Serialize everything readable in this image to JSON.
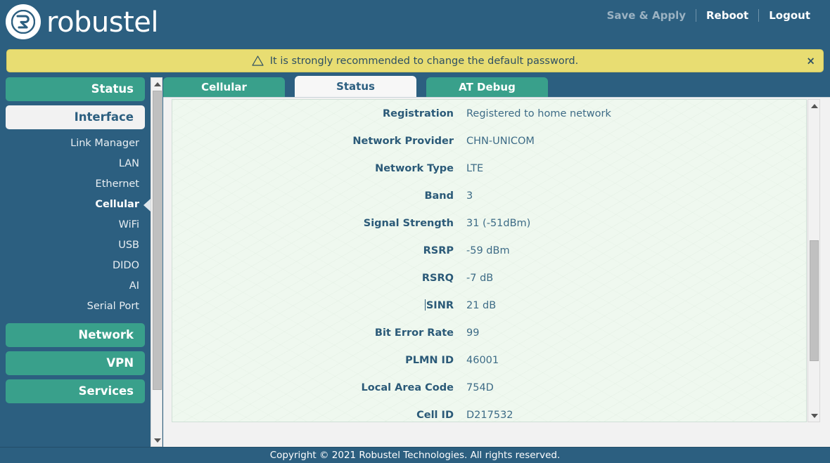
{
  "brand": {
    "name": "robustel",
    "logo_icon": "robustel-logo-icon"
  },
  "header": {
    "save_apply_label": "Save & Apply",
    "reboot_label": "Reboot",
    "logout_label": "Logout"
  },
  "banner": {
    "icon": "warning-triangle-icon",
    "message": "It is strongly recommended to change the default password.",
    "close_label": "×",
    "bg_color": "#e8dd72",
    "text_color": "#2d4f63"
  },
  "sidebar": {
    "groups": [
      {
        "label": "Status",
        "state": "collapsed"
      },
      {
        "label": "Interface",
        "state": "open"
      },
      {
        "label": "Network",
        "state": "collapsed"
      },
      {
        "label": "VPN",
        "state": "collapsed"
      },
      {
        "label": "Services",
        "state": "collapsed"
      }
    ],
    "interface_items": [
      {
        "label": "Link Manager",
        "active": false
      },
      {
        "label": "LAN",
        "active": false
      },
      {
        "label": "Ethernet",
        "active": false
      },
      {
        "label": "Cellular",
        "active": true
      },
      {
        "label": "WiFi",
        "active": false
      },
      {
        "label": "USB",
        "active": false
      },
      {
        "label": "DIDO",
        "active": false
      },
      {
        "label": "AI",
        "active": false
      },
      {
        "label": "Serial Port",
        "active": false
      }
    ],
    "active_marker_icon": "left-caret-icon",
    "scrollbar": {
      "up_icon": "scroll-up-arrow-icon",
      "down_icon": "scroll-down-arrow-icon"
    }
  },
  "tabs": [
    {
      "label": "Cellular",
      "active": false
    },
    {
      "label": "Status",
      "active": true
    },
    {
      "label": "AT Debug",
      "active": false
    }
  ],
  "status_rows": [
    {
      "label": "Registration",
      "value": "Registered to home network",
      "caret": false
    },
    {
      "label": "Network Provider",
      "value": "CHN-UNICOM",
      "caret": false
    },
    {
      "label": "Network Type",
      "value": "LTE",
      "caret": false
    },
    {
      "label": "Band",
      "value": "3",
      "caret": false
    },
    {
      "label": "Signal Strength",
      "value": "31 (-51dBm)",
      "caret": false
    },
    {
      "label": "RSRP",
      "value": "-59 dBm",
      "caret": false
    },
    {
      "label": "RSRQ",
      "value": "-7 dB",
      "caret": false
    },
    {
      "label": "SINR",
      "value": "21 dB",
      "caret": true
    },
    {
      "label": "Bit Error Rate",
      "value": "99",
      "caret": false
    },
    {
      "label": "PLMN ID",
      "value": "46001",
      "caret": false
    },
    {
      "label": "Local Area Code",
      "value": "754D",
      "caret": false
    },
    {
      "label": "Cell ID",
      "value": "D217532",
      "caret": false
    }
  ],
  "content_scrollbar": {
    "up_icon": "scroll-up-arrow-icon",
    "down_icon": "scroll-down-arrow-icon"
  },
  "footer": {
    "copyright": "Copyright © 2021 Robustel Technologies. All rights reserved."
  },
  "colors": {
    "header_blue": "#2c5f80",
    "accent_teal": "#39a08b",
    "banner_yellow": "#e8dd72",
    "panel_green": "#eff8ef",
    "label_blue": "#2b5a78"
  }
}
